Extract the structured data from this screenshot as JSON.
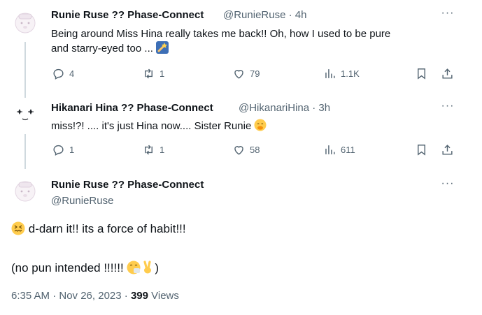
{
  "tweets": [
    {
      "author_name": "Runie Ruse ?? Phase-Connect",
      "handle_time": "@RunieRuse · 4h",
      "text_line1": "Being around Miss Hina really takes me back!! Oh, how I used to be pure",
      "text_line2": "and starry-eyed too ...",
      "stats": {
        "replies": "4",
        "retweets": "1",
        "likes": "79",
        "views": "1.1K"
      }
    },
    {
      "author_name": "Hikanari Hina ?? Phase-Connect",
      "handle_time": "@HikanariHina · 3h",
      "text_line1": "miss!?! .... it's just Hina now.... Sister Runie",
      "stats": {
        "replies": "1",
        "retweets": "1",
        "likes": "58",
        "views": "611"
      }
    }
  ],
  "main_tweet": {
    "author_name": "Runie Ruse ?? Phase-Connect",
    "handle": "@RunieRuse",
    "line1": "d-darn it!! its a force of habit!!!",
    "line2_pre": "(no pun intended !!!!!! ",
    "line2_post": ")",
    "time": "6:35 AM · Nov 26, 2023 · ",
    "views_count": "399",
    "views_label": " Views"
  },
  "colors": {
    "text": "#0f1419",
    "muted": "#536471",
    "thread_line": "#cfd9de"
  }
}
